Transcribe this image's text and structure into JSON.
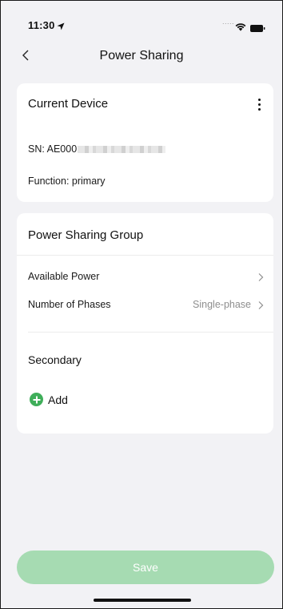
{
  "status_bar": {
    "time": "11:30",
    "location_icon": "location-arrow-icon",
    "signal_dots": ".....",
    "wifi_icon": "wifi-icon",
    "battery_icon": "battery-icon"
  },
  "nav": {
    "back_icon": "chevron-left-icon",
    "title": "Power Sharing"
  },
  "current_device": {
    "heading": "Current Device",
    "more_icon": "more-vertical-icon",
    "sn_label": "SN: AE000",
    "function_label": "Function: primary"
  },
  "power_sharing_group": {
    "heading": "Power Sharing Group",
    "rows": [
      {
        "label": "Available Power",
        "value": ""
      },
      {
        "label": "Number of Phases",
        "value": "Single-phase"
      }
    ],
    "secondary_heading": "Secondary",
    "add_icon": "plus-circle-icon",
    "add_label": "Add"
  },
  "footer": {
    "save_label": "Save"
  },
  "colors": {
    "background": "#f2f2f5",
    "card": "#ffffff",
    "accent_green": "#3fae5a",
    "save_disabled": "#a6dbb2",
    "secondary_text": "#8e8e8e"
  }
}
